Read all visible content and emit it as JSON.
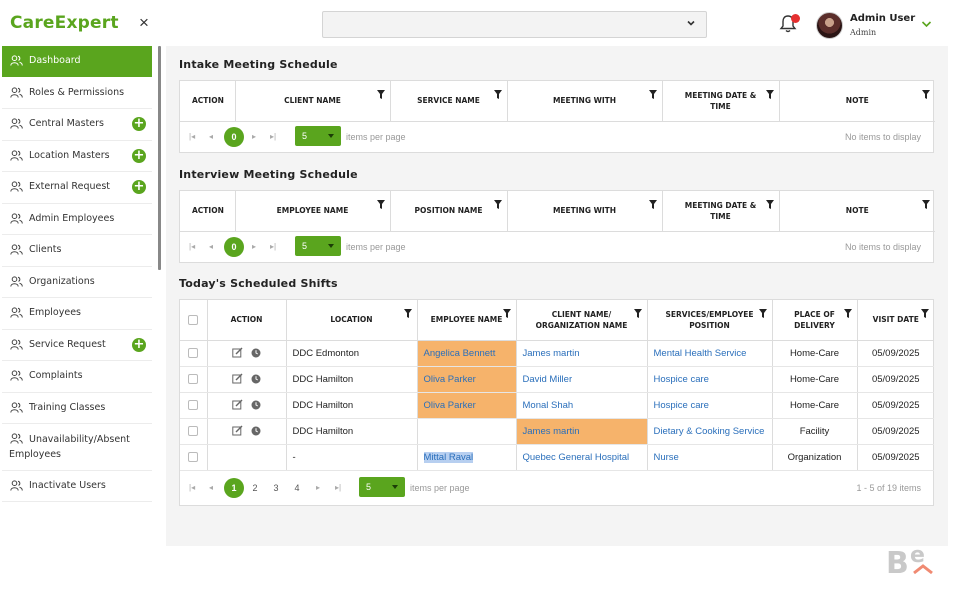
{
  "header": {
    "brand": "CareExpert",
    "close_symbol": "×",
    "user_name": "Admin User",
    "user_role": "Admin",
    "top_select_value": ""
  },
  "sidebar": {
    "items": [
      {
        "label": "Dashboard",
        "active": true,
        "add": false
      },
      {
        "label": "Roles & Permissions",
        "add": false
      },
      {
        "label": "Central Masters",
        "add": true
      },
      {
        "label": "Location Masters",
        "add": true
      },
      {
        "label": "External Request",
        "add": true
      },
      {
        "label": "Admin Employees",
        "add": false
      },
      {
        "label": "Clients",
        "add": false
      },
      {
        "label": "Organizations",
        "add": false
      },
      {
        "label": "Employees",
        "add": false
      },
      {
        "label": "Service Request",
        "add": true
      },
      {
        "label": "Complaints",
        "add": false
      },
      {
        "label": "Training Classes",
        "add": false
      },
      {
        "label": "Unavailability/Absent Employees",
        "add": false
      },
      {
        "label": "Inactivate Users",
        "add": false
      }
    ]
  },
  "intake": {
    "title": "Intake Meeting Schedule",
    "columns": [
      "Action",
      "Client Name",
      "Service Name",
      "Meeting With",
      "Meeting Date & Time",
      "Note"
    ],
    "page": "0",
    "page_size": "5",
    "items_per_page": "items per page",
    "empty": "No items to display"
  },
  "interview": {
    "title": "Interview Meeting Schedule",
    "columns": [
      "Action",
      "Employee Name",
      "Position Name",
      "Meeting With",
      "Meeting Date & Time",
      "Note"
    ],
    "page": "0",
    "page_size": "5",
    "items_per_page": "items per page",
    "empty": "No items to display"
  },
  "shifts": {
    "title": "Today's Scheduled Shifts",
    "columns": [
      "Action",
      "Location",
      "Employee Name",
      "Client Name/ Organization Name",
      "Services/Employee Position",
      "Place of Delivery",
      "Visit Date"
    ],
    "rows": [
      {
        "location": "DDC Edmonton",
        "employee": "Angelica Bennett",
        "client": "James martin",
        "service": "Mental Health Service",
        "place": "Home-Care",
        "date": "05/09/2025",
        "hl_emp": true,
        "hl_client": false,
        "actions": true
      },
      {
        "location": "DDC Hamilton",
        "employee": "Oliva Parker",
        "client": "David Miller",
        "service": "Hospice care",
        "place": "Home-Care",
        "date": "05/09/2025",
        "hl_emp": true,
        "hl_client": false,
        "actions": true
      },
      {
        "location": "DDC Hamilton",
        "employee": "Oliva Parker",
        "client": "Monal Shah",
        "service": "Hospice care",
        "place": "Home-Care",
        "date": "05/09/2025",
        "hl_emp": true,
        "hl_client": false,
        "actions": true
      },
      {
        "location": "DDC Hamilton",
        "employee": "",
        "client": "James martin",
        "service": "Dietary & Cooking Service",
        "place": "Facility",
        "date": "05/09/2025",
        "hl_emp": false,
        "hl_client": true,
        "actions": true
      },
      {
        "location": "-",
        "employee": "Mittal Raval",
        "client": "Quebec General Hospital",
        "service": "Nurse",
        "place": "Organization",
        "date": "05/09/2025",
        "hl_emp": false,
        "hl_client": false,
        "actions": false
      }
    ],
    "pages": [
      "1",
      "2",
      "3",
      "4"
    ],
    "current_page": "1",
    "page_size": "5",
    "items_per_page": "items per page",
    "info": "1 - 5 of 19 items"
  },
  "colors": {
    "accent": "#5aa51e",
    "highlight": "#f6b36b",
    "link": "#2a6fbb"
  }
}
